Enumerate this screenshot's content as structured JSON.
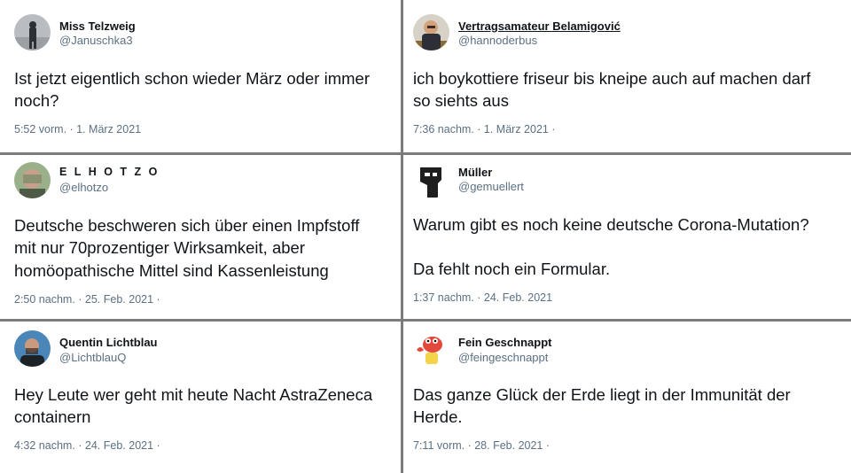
{
  "tweets": [
    {
      "name": "Miss Telzweig",
      "handle": "@Januschka3",
      "lines": [
        "Ist jetzt eigentlich schon wieder März oder immer",
        "noch?"
      ],
      "time": "5:52 vorm. · 1. März 2021"
    },
    {
      "name": "Vertragsamateur Belamigović",
      "handle": "@hannoderbus",
      "lines": [
        "ich boykottiere friseur bis kneipe auch auf machen darf",
        "so siehts aus"
      ],
      "time": "7:36 nachm. · 1. März 2021 ·"
    },
    {
      "name": "E L H O T Z O",
      "handle": "@elhotzo",
      "lines": [
        "Deutsche beschweren sich über einen Impfstoff",
        "mit nur 70prozentiger Wirksamkeit, aber",
        "homöopathische Mittel sind Kassenleistung"
      ],
      "time": "2:50 nachm. · 25. Feb. 2021 ·"
    },
    {
      "name": "Müller",
      "handle": "@gemuellert",
      "lines": [
        "Warum gibt es noch keine deutsche Corona-Mutation?",
        "",
        "Da fehlt noch ein Formular."
      ],
      "time": "1:37 nachm. · 24. Feb. 2021"
    },
    {
      "name": "Quentin Lichtblau",
      "handle": "@LichtblauQ",
      "lines": [
        "Hey Leute wer geht mit heute Nacht AstraZeneca",
        "containern"
      ],
      "time": "4:32 nachm. · 24. Feb. 2021 ·"
    },
    {
      "name": "Fein Geschnappt",
      "handle": "@feingeschnappt",
      "lines": [
        "Das ganze Glück der Erde liegt in der Immunität der",
        "Herde."
      ],
      "time": "7:11 vorm. · 28. Feb. 2021 ·"
    }
  ]
}
